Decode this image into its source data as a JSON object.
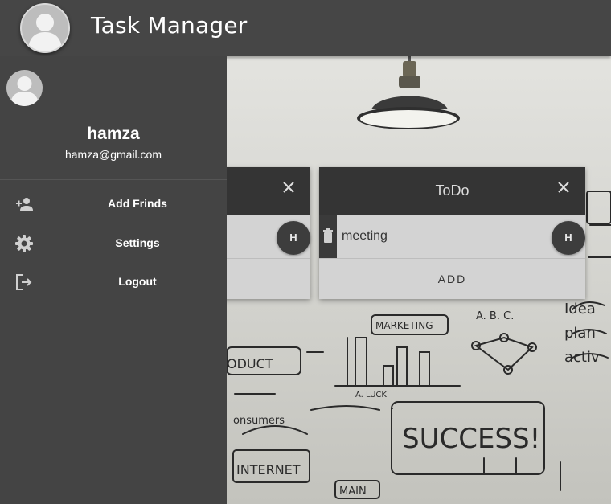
{
  "app": {
    "title": "Task Manager",
    "avatar_icon": "user-avatar-icon"
  },
  "drawer": {
    "user_name": "hamza",
    "user_email": "hamza@gmail.com",
    "avatar_icon": "user-avatar-icon",
    "items": [
      {
        "label": "Add Frinds",
        "icon": "person-add-icon"
      },
      {
        "label": "Settings",
        "icon": "gear-icon"
      },
      {
        "label": "Logout",
        "icon": "logout-icon"
      }
    ]
  },
  "boards": [
    {
      "title": "",
      "tasks": [
        {
          "text": "",
          "assignee_initial": "H"
        }
      ]
    },
    {
      "title": "ToDo",
      "tasks": [
        {
          "text": "meeting",
          "assignee_initial": "H"
        }
      ],
      "add_label": "ADD"
    }
  ],
  "colors": {
    "appbar": "#464646",
    "drawer": "#444444",
    "board_header": "#343434",
    "board_body": "#d3d3d3"
  }
}
